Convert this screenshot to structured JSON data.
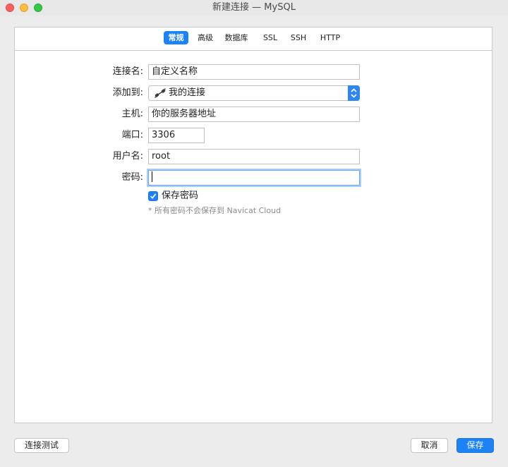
{
  "window": {
    "title": "新建连接 — MySQL"
  },
  "tabs": [
    {
      "label": "常规",
      "active": true
    },
    {
      "label": "高级",
      "active": false
    },
    {
      "label": "数据库",
      "active": false
    },
    {
      "label": "SSL",
      "active": false
    },
    {
      "label": "SSH",
      "active": false
    },
    {
      "label": "HTTP",
      "active": false
    }
  ],
  "form": {
    "connection_name": {
      "label": "连接名:",
      "value": "自定义名称"
    },
    "add_to": {
      "label": "添加到:",
      "value": "我的连接",
      "icon": "connection-plug-icon"
    },
    "host": {
      "label": "主机:",
      "value": "你的服务器地址"
    },
    "port": {
      "label": "端口:",
      "value": "3306"
    },
    "username": {
      "label": "用户名:",
      "value": "root"
    },
    "password": {
      "label": "密码:",
      "value": ""
    },
    "save_password": {
      "label": "保存密码",
      "checked": true
    },
    "note": "* 所有密码不会保存到 Navicat Cloud"
  },
  "buttons": {
    "test_connection": "连接测试",
    "cancel": "取消",
    "save": "保存"
  },
  "colors": {
    "accent": "#1d82f6",
    "close": "#fc605c",
    "minimize": "#fdbc40",
    "maximize": "#34c84a"
  }
}
